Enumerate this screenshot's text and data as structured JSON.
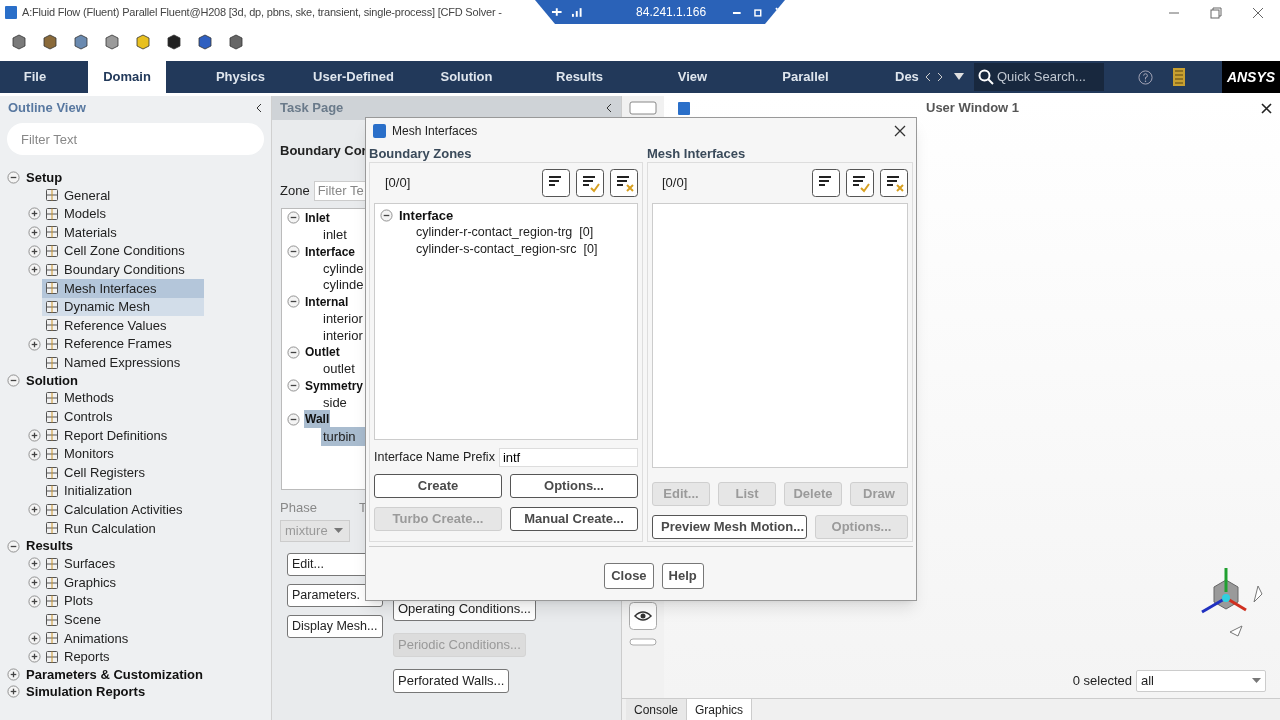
{
  "window": {
    "title": "A:Fluid Flow (Fluent) Parallel Fluent@H208  [3d, dp, pbns, ske, transient, single-process] [CFD Solver -"
  },
  "remote_bar": {
    "address": "84.241.1.166"
  },
  "ribbon": {
    "tabs": [
      {
        "label": "File",
        "selected": false
      },
      {
        "label": "Domain",
        "selected": true
      },
      {
        "label": "Physics",
        "selected": false
      },
      {
        "label": "User-Defined",
        "selected": false
      },
      {
        "label": "Solution",
        "selected": false
      },
      {
        "label": "Results",
        "selected": false
      },
      {
        "label": "View",
        "selected": false
      },
      {
        "label": "Parallel",
        "selected": false
      },
      {
        "label": "Des",
        "selected": false
      }
    ],
    "search": {
      "placeholder": "Quick Search..."
    },
    "logo": "ANSYS"
  },
  "outline": {
    "title": "Outline View",
    "filter": {
      "placeholder": "Filter Text"
    },
    "items": [
      {
        "label": "Setup",
        "kind": "group",
        "expanded": true,
        "children": [
          {
            "label": "General",
            "kind": "leaf",
            "selected": false
          },
          {
            "label": "Models",
            "kind": "group",
            "expanded": false,
            "selected": false
          },
          {
            "label": "Materials",
            "kind": "group",
            "expanded": false,
            "selected": false
          },
          {
            "label": "Cell Zone Conditions",
            "kind": "group",
            "expanded": false,
            "selected": false
          },
          {
            "label": "Boundary Conditions",
            "kind": "group",
            "expanded": false,
            "selected": false
          },
          {
            "label": "Mesh Interfaces",
            "kind": "leaf",
            "selected": true
          },
          {
            "label": "Dynamic Mesh",
            "kind": "leaf",
            "selected": false,
            "hovered": true
          },
          {
            "label": "Reference Values",
            "kind": "leaf",
            "selected": false
          },
          {
            "label": "Reference Frames",
            "kind": "group",
            "expanded": false,
            "selected": false
          },
          {
            "label": "Named Expressions",
            "kind": "leaf",
            "selected": false
          }
        ]
      },
      {
        "label": "Solution",
        "kind": "group",
        "expanded": true,
        "children": [
          {
            "label": "Methods",
            "kind": "leaf",
            "selected": false
          },
          {
            "label": "Controls",
            "kind": "leaf",
            "selected": false
          },
          {
            "label": "Report Definitions",
            "kind": "group",
            "expanded": false,
            "selected": false
          },
          {
            "label": "Monitors",
            "kind": "group",
            "expanded": false,
            "selected": false
          },
          {
            "label": "Cell Registers",
            "kind": "leaf",
            "selected": false
          },
          {
            "label": "Initialization",
            "kind": "leaf",
            "selected": false
          },
          {
            "label": "Calculation Activities",
            "kind": "group",
            "expanded": false,
            "selected": false
          },
          {
            "label": "Run Calculation",
            "kind": "leaf",
            "selected": false
          }
        ]
      },
      {
        "label": "Results",
        "kind": "group",
        "expanded": true,
        "children": [
          {
            "label": "Surfaces",
            "kind": "group",
            "expanded": false,
            "selected": false
          },
          {
            "label": "Graphics",
            "kind": "group",
            "expanded": false,
            "selected": false
          },
          {
            "label": "Plots",
            "kind": "group",
            "expanded": false,
            "selected": false
          },
          {
            "label": "Scene",
            "kind": "leaf",
            "selected": false
          },
          {
            "label": "Animations",
            "kind": "group",
            "expanded": false,
            "selected": false
          },
          {
            "label": "Reports",
            "kind": "group",
            "expanded": false,
            "selected": false
          }
        ]
      },
      {
        "label": "Parameters & Customization",
        "kind": "group",
        "expanded": false
      },
      {
        "label": "Simulation Reports",
        "kind": "group",
        "expanded": false
      }
    ]
  },
  "task_page": {
    "title": "Task Page",
    "heading": "Boundary Cor",
    "zone_label": "Zone",
    "zone_filter": {
      "placeholder": "Filter Te"
    },
    "zones": [
      {
        "label": "Inlet",
        "expanded": true,
        "selected": false,
        "children": [
          {
            "label": "inlet",
            "selected": false
          }
        ]
      },
      {
        "label": "Interface",
        "expanded": true,
        "selected": false,
        "children": [
          {
            "label": "cylinde",
            "selected": false
          },
          {
            "label": "cylinde",
            "selected": false
          }
        ]
      },
      {
        "label": "Internal",
        "expanded": true,
        "selected": false,
        "children": [
          {
            "label": "interior",
            "selected": false
          },
          {
            "label": "interior",
            "selected": false
          }
        ]
      },
      {
        "label": "Outlet",
        "expanded": true,
        "selected": false,
        "children": [
          {
            "label": "outlet",
            "selected": false
          }
        ]
      },
      {
        "label": "Symmetry",
        "expanded": true,
        "selected": false,
        "children": [
          {
            "label": "side",
            "selected": false
          }
        ]
      },
      {
        "label": "Wall",
        "expanded": true,
        "selected": true,
        "children": [
          {
            "label": "turbin",
            "selected": true
          }
        ]
      }
    ],
    "phase_label": "Phase",
    "type_label": "T",
    "phase_value": "mixture",
    "buttons": [
      {
        "label": "Edit...",
        "disabled": false
      },
      {
        "label": "Parameters.",
        "disabled": false
      },
      {
        "label": "Display Mesh...",
        "disabled": false
      }
    ],
    "condition_buttons": [
      {
        "label": "Operating Conditions...",
        "disabled": false
      },
      {
        "label": "Periodic Conditions...",
        "disabled": true
      },
      {
        "label": "Perforated Walls...",
        "disabled": false
      }
    ]
  },
  "dialog": {
    "title": "Mesh Interfaces",
    "zones": {
      "title": "Boundary Zones",
      "count": "[0/0]",
      "groups": [
        {
          "label": "Interface",
          "expanded": true,
          "children": [
            {
              "label": "cylinder-r-contact_region-trg",
              "count": "[0]",
              "selected": false
            },
            {
              "label": "cylinder-s-contact_region-src",
              "count": "[0]",
              "selected": false
            }
          ]
        }
      ],
      "prefix_label": "Interface Name Prefix",
      "prefix_value": "intf",
      "buttons": [
        {
          "label": "Create",
          "disabled": false
        },
        {
          "label": "Options...",
          "disabled": false
        },
        {
          "label": "Turbo Create...",
          "disabled": true
        },
        {
          "label": "Manual Create...",
          "disabled": false
        }
      ]
    },
    "interfaces": {
      "title": "Mesh Interfaces",
      "count": "[0/0]",
      "buttons": [
        {
          "label": "Edit...",
          "disabled": true
        },
        {
          "label": "List",
          "disabled": true
        },
        {
          "label": "Delete",
          "disabled": true
        },
        {
          "label": "Draw",
          "disabled": true
        }
      ],
      "buttons2": [
        {
          "label": "Preview Mesh Motion...",
          "disabled": false
        },
        {
          "label": "Options...",
          "disabled": true
        }
      ]
    },
    "footer_buttons": [
      {
        "label": "Close"
      },
      {
        "label": "Help"
      }
    ]
  },
  "graphics": {
    "title": "User Window 1",
    "selected_count": "0 selected",
    "filter_value": "all",
    "tabs": [
      {
        "label": "Console",
        "selected": false
      },
      {
        "label": "Graphics",
        "selected": true
      }
    ]
  }
}
